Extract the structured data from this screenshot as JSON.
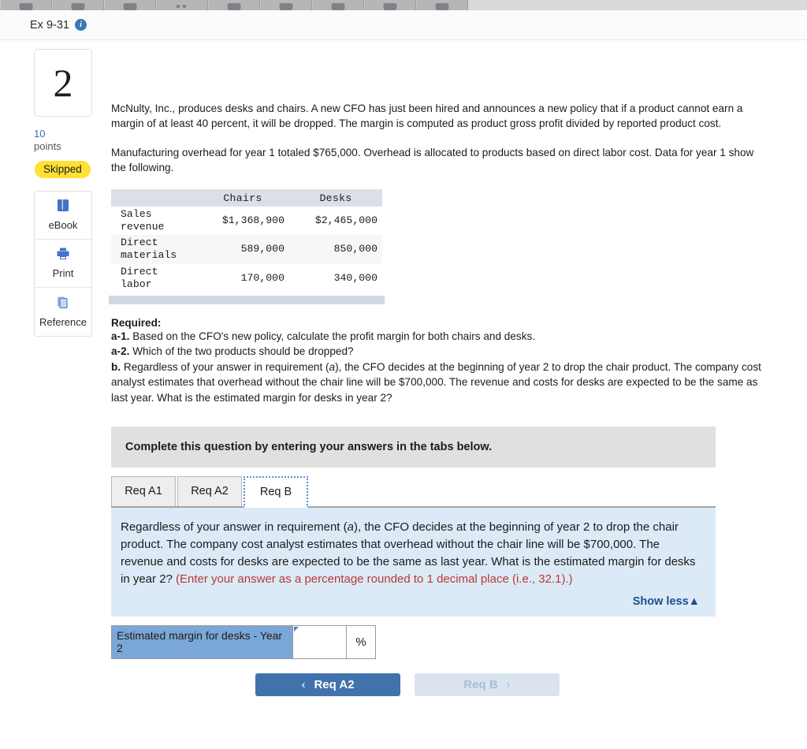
{
  "browser": {
    "tab_count": 9,
    "favicon_name": "generic-favicon"
  },
  "header": {
    "title": "Ex 9-31",
    "info_icon": "info-icon",
    "info_glyph": "i"
  },
  "rail": {
    "question_number": "2",
    "points_value": "10",
    "points_label": "points",
    "status": "Skipped",
    "tools": [
      {
        "label": "eBook",
        "icon": "ebook-icon"
      },
      {
        "label": "Print",
        "icon": "printer-icon"
      },
      {
        "label": "Reference",
        "icon": "reference-pages-icon"
      }
    ]
  },
  "problem": {
    "intro": "McNulty, Inc., produces desks and chairs. A new CFO has just been hired and announces a new policy that if a product cannot earn a margin of at least 40 percent, it will be dropped. The margin is computed as product gross profit divided by reported product cost.",
    "overhead": "Manufacturing overhead for year 1 totaled $765,000. Overhead is allocated to products based on direct labor cost. Data for year 1 show the following."
  },
  "data_table": {
    "columns": [
      "",
      "Chairs",
      "Desks"
    ],
    "rows": [
      {
        "label": "Sales\nrevenue",
        "chairs": "$1,368,900",
        "desks": "$2,465,000"
      },
      {
        "label": "Direct\nmaterials",
        "chairs": "589,000",
        "desks": "850,000"
      },
      {
        "label": "Direct\nlabor",
        "chairs": "170,000",
        "desks": "340,000"
      }
    ]
  },
  "required": {
    "heading": "Required:",
    "a1_marker": "a-1.",
    "a1_text": " Based on the CFO's new policy, calculate the profit margin for both chairs and desks.",
    "a2_marker": "a-2.",
    "a2_text": " Which of the two products should be dropped?",
    "b_marker": "b.",
    "b_text_1": " Regardless of your answer in requirement (",
    "b_italic": "a",
    "b_text_2": "), the CFO decides at the beginning of year 2 to drop the chair product. The company cost analyst estimates that overhead without the chair line will be $700,000. The revenue and costs for desks are expected to be the same as last year. What is the estimated margin for desks in year 2?"
  },
  "complete_banner": {
    "text": "Complete this question by entering your answers in the tabs below."
  },
  "tabs": {
    "items": [
      {
        "label": "Req A1",
        "active": false
      },
      {
        "label": "Req A2",
        "active": false
      },
      {
        "label": "Req B",
        "active": true
      }
    ]
  },
  "instruction": {
    "text_1": "Regardless of your answer in requirement (",
    "italic": "a",
    "text_2": "), the CFO decides at the beginning of year 2 to drop the chair product. The company cost analyst estimates that overhead without the chair line will be $700,000. The revenue and costs for desks are expected to be the same as last year. What is the estimated margin for desks in year 2? ",
    "red_note": "(Enter your answer as a percentage rounded to 1 decimal place (i.e., 32.1).)",
    "show_less": "Show less",
    "show_less_icon": "triangle-up-icon"
  },
  "answer": {
    "label": "Estimated margin for desks - Year 2",
    "value": "",
    "placeholder": "",
    "unit": "%"
  },
  "nav": {
    "prev_label": "Req A2",
    "prev_icon": "chevron-left-icon",
    "prev_glyph": "‹",
    "next_label": "Req B",
    "next_icon": "chevron-right-icon",
    "next_glyph": "›"
  },
  "colors": {
    "accent_blue": "#4272ac",
    "panel_blue": "#dceaf7",
    "label_blue": "#7ba7d7",
    "banner_gray": "#e0e0e0",
    "badge_yellow": "#ffe033",
    "red_note": "#b73a31"
  }
}
